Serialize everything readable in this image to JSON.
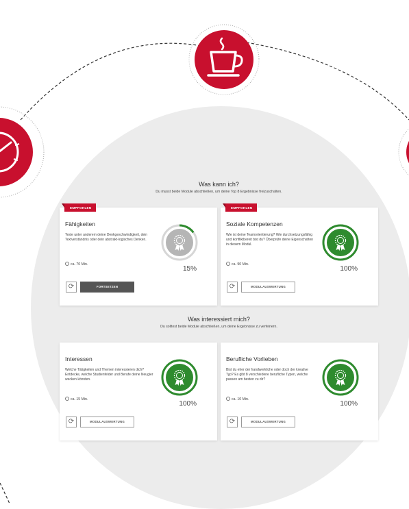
{
  "section_skills": {
    "title": "Was kann ich?",
    "subtitle": "Du musst beide Module abschließen, um deine Top 8 Ergebnisse freizuschalten."
  },
  "section_interests": {
    "title": "Was interessiert mich?",
    "subtitle": "Du solltest beide Module abschließen, um deine Ergebnisse zu verfeinern."
  },
  "cards": [
    {
      "badge": "EMPFOHLEN",
      "title": "Fähigkeiten",
      "description": "Teste unter anderem deine Denkgeschwindigkeit, dein Textverständnis oder dein abstrakt-logisches Denken.",
      "time": "ca. 70 Min.",
      "percent": "15%",
      "progress": 0.15,
      "button": "FORTSETZEN",
      "status": "in-progress"
    },
    {
      "badge": "EMPFOHLEN",
      "title": "Soziale Kompetenzen",
      "description": "Wie ist deine Teamorientierung? Wie durchsetzungsfähig und konfliktbereit bist du? Überprüfe deine Eigenschaften in diesem Modul.",
      "time": "ca. 90 Min.",
      "percent": "100%",
      "progress": 1.0,
      "button": "MODULAUSWERTUNG",
      "status": "complete"
    },
    {
      "badge": "",
      "title": "Interessen",
      "description": "Welche Tätigkeiten und Themen interessieren dich? Entdecke, welche Studienfelder und Berufe deine Neugier wecken könnten.",
      "time": "ca. 15 Min.",
      "percent": "100%",
      "progress": 1.0,
      "button": "MODULAUSWERTUNG",
      "status": "complete"
    },
    {
      "badge": "",
      "title": "Berufliche Vorlieben",
      "description": "Bist du eher der handwerkliche oder doch der kreative Typ? Es gibt 8 verschiedene berufliche Typen, welche passen am besten zu dir?",
      "time": "ca. 10 Min.",
      "percent": "100%",
      "progress": 1.0,
      "button": "MODULAUSWERTUNG",
      "status": "complete"
    }
  ],
  "icons": {
    "top": "coffee-cup-icon",
    "left": "stopwatch-icon",
    "right": "partial-badge-icon",
    "award": "award-medal-icon",
    "clock": "clock-icon",
    "reset": "reset-icon"
  },
  "colors": {
    "brand_red": "#c8102e",
    "complete_green": "#2e8b2e",
    "background_gray": "#ececec"
  }
}
